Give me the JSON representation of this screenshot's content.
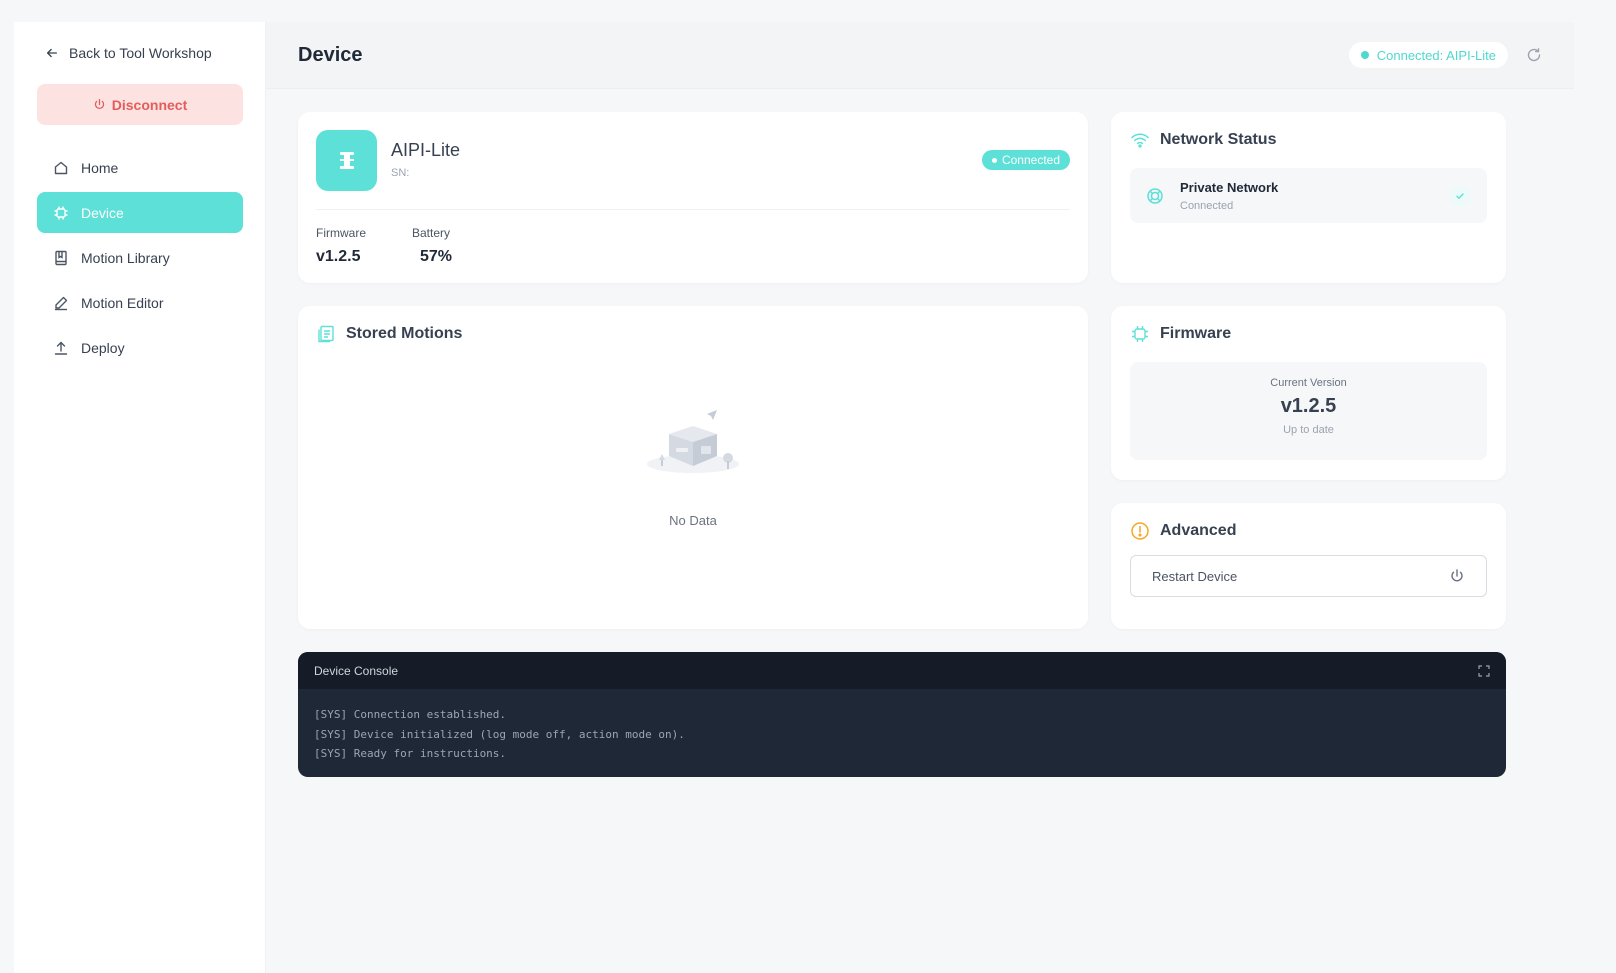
{
  "colors": {
    "accent": "#5ce0d8",
    "danger": "#e35d5b",
    "danger_bg": "#fde2e2",
    "warning": "#f5a623",
    "console_bg": "#1e2836"
  },
  "sidebar": {
    "back_label": "Back to Tool Workshop",
    "disconnect_label": "Disconnect",
    "items": [
      {
        "label": "Home",
        "icon": "home-icon",
        "active": false
      },
      {
        "label": "Device",
        "icon": "chip-icon",
        "active": true
      },
      {
        "label": "Motion Library",
        "icon": "book-icon",
        "active": false
      },
      {
        "label": "Motion Editor",
        "icon": "pen-icon",
        "active": false
      },
      {
        "label": "Deploy",
        "icon": "upload-icon",
        "active": false
      }
    ]
  },
  "header": {
    "title": "Device",
    "connection_status": "Connected: AIPI-Lite"
  },
  "device": {
    "name": "AIPI-Lite",
    "sn_label": "SN:",
    "status": "Connected",
    "firmware_label": "Firmware",
    "firmware_value": "v1.2.5",
    "battery_label": "Battery",
    "battery_value": "57%"
  },
  "network": {
    "title": "Network Status",
    "name": "Private Network",
    "state": "Connected"
  },
  "stored_motions": {
    "title": "Stored Motions",
    "empty_text": "No Data"
  },
  "firmware": {
    "title": "Firmware",
    "current_label": "Current Version",
    "version": "v1.2.5",
    "status": "Up to date"
  },
  "advanced": {
    "title": "Advanced",
    "restart_label": "Restart Device"
  },
  "console": {
    "title": "Device Console",
    "lines": [
      "[SYS] Connection established.",
      "[SYS] Device initialized (log mode off, action mode on).",
      "[SYS] Ready for instructions."
    ]
  }
}
